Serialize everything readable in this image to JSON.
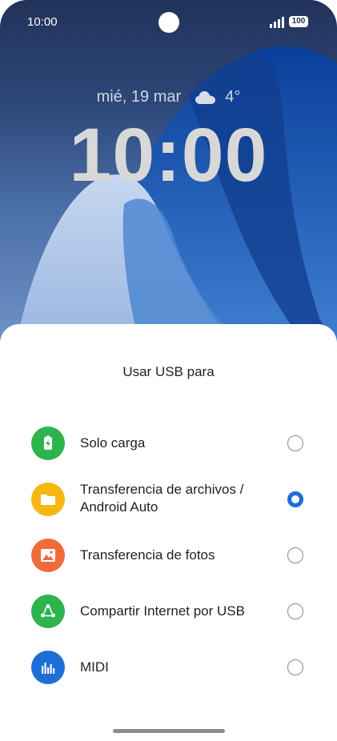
{
  "status_bar": {
    "time": "10:00",
    "battery": "100"
  },
  "lockscreen": {
    "date": "mié, 19 mar",
    "temperature": "4°",
    "clock": "10:00"
  },
  "usb_dialog": {
    "title": "Usar USB para",
    "options": [
      {
        "label": "Solo carga",
        "icon": "battery-charging-icon",
        "color": "#2cb44e",
        "selected": false
      },
      {
        "label": "Transferencia de archivos / Android Auto",
        "icon": "folder-icon",
        "color": "#f5b712",
        "selected": true
      },
      {
        "label": "Transferencia de fotos",
        "icon": "image-icon",
        "color": "#f06a3c",
        "selected": false
      },
      {
        "label": "Compartir Internet por USB",
        "icon": "share-icon",
        "color": "#2cb44e",
        "selected": false
      },
      {
        "label": "MIDI",
        "icon": "midi-icon",
        "color": "#1e6ed8",
        "selected": false
      }
    ]
  },
  "colors": {
    "accent": "#1e6ed8"
  }
}
